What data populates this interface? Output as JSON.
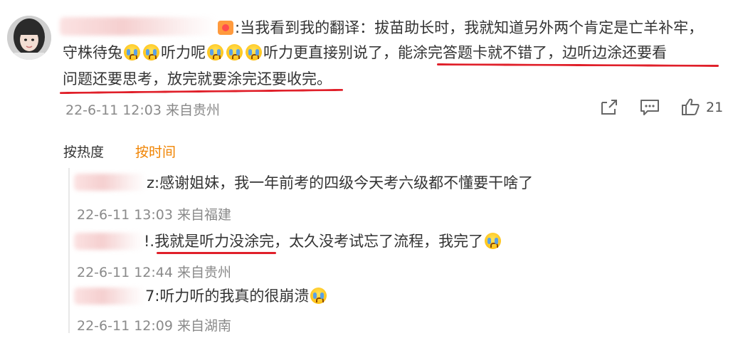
{
  "comment": {
    "text_line1": ":当我看到我的翻译：拔苗助长时，我就知道另外两个肯定是亡羊补牢，",
    "text_line2_a": "守株待兔",
    "text_line2_b": "听力呢",
    "text_line2_c": "听力更直接别说了，",
    "text_line2_d": "能涂完答题卡就不错了，边听边涂还要看",
    "text_line3": "问题还要思考，放完就要涂完还要收完。",
    "timestamp": "22-6-11 12:03 来自贵州",
    "like_count": "21"
  },
  "sort_tabs": {
    "hot": "按热度",
    "time": "按时间",
    "active_color": "#f08300"
  },
  "replies": [
    {
      "text": "z:感谢姐妹，我一年前考的四级今天考六级都不懂要干啥了",
      "timestamp": "22-6-11 13:03 来自福建"
    },
    {
      "prefix": "!.",
      "text_underlined": "我就是听力没涂完",
      "text_rest": "，太久没考试忘了流程，我完了",
      "timestamp": "22-6-11 12:44 来自贵州"
    },
    {
      "text": "7:听力听的我真的很崩溃",
      "timestamp": "22-6-11 12:09 来自湖南"
    }
  ],
  "icons": {
    "share": "share-icon",
    "comment": "comment-icon",
    "like": "like-icon",
    "crying_emoji": "crying-face-icon"
  },
  "colors": {
    "underline": "#e0202a",
    "meta_text": "#8a8a8a",
    "body_text": "#333333"
  }
}
